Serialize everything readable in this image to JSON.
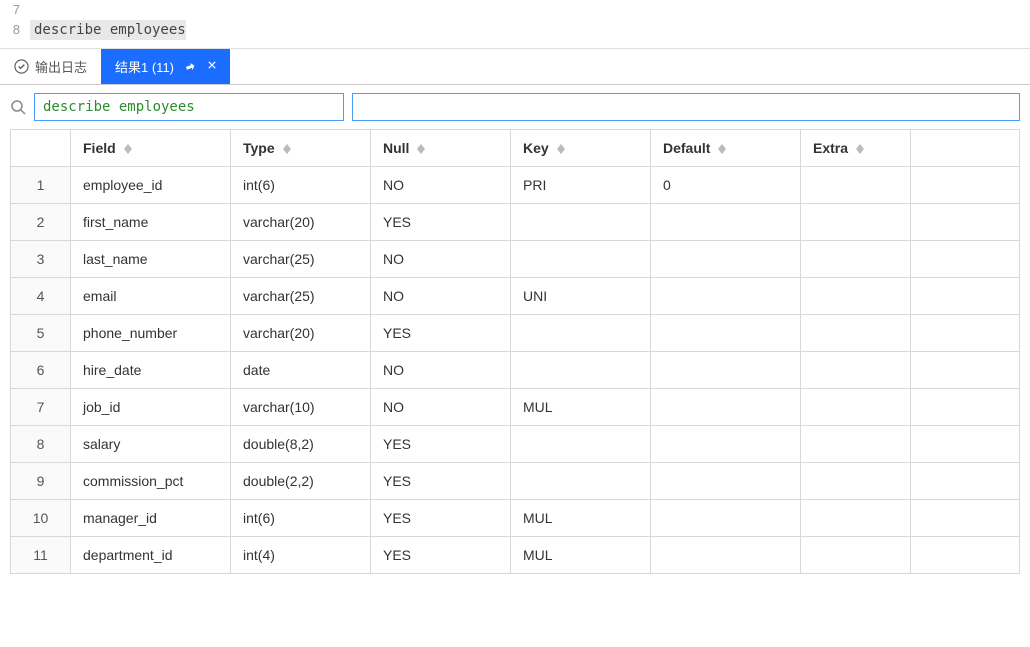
{
  "editor": {
    "lines": [
      {
        "num": "7",
        "text": ""
      },
      {
        "num": "8",
        "text": "describe employees"
      }
    ]
  },
  "tabs": {
    "output_log": "输出日志",
    "result": "结果1 (11)"
  },
  "search": {
    "query": "describe employees",
    "filter_placeholder": ""
  },
  "table": {
    "headers": {
      "rownum": "",
      "field": "Field",
      "type": "Type",
      "null": "Null",
      "key": "Key",
      "default": "Default",
      "extra": "Extra"
    },
    "rows": [
      {
        "n": "1",
        "field": "employee_id",
        "type": "int(6)",
        "null": "NO",
        "key": "PRI",
        "default": "0",
        "extra": ""
      },
      {
        "n": "2",
        "field": "first_name",
        "type": "varchar(20)",
        "null": "YES",
        "key": "",
        "default": "",
        "extra": ""
      },
      {
        "n": "3",
        "field": "last_name",
        "type": "varchar(25)",
        "null": "NO",
        "key": "",
        "default": "",
        "extra": ""
      },
      {
        "n": "4",
        "field": "email",
        "type": "varchar(25)",
        "null": "NO",
        "key": "UNI",
        "default": "",
        "extra": ""
      },
      {
        "n": "5",
        "field": "phone_number",
        "type": "varchar(20)",
        "null": "YES",
        "key": "",
        "default": "",
        "extra": ""
      },
      {
        "n": "6",
        "field": "hire_date",
        "type": "date",
        "null": "NO",
        "key": "",
        "default": "",
        "extra": ""
      },
      {
        "n": "7",
        "field": "job_id",
        "type": "varchar(10)",
        "null": "NO",
        "key": "MUL",
        "default": "",
        "extra": ""
      },
      {
        "n": "8",
        "field": "salary",
        "type": "double(8,2)",
        "null": "YES",
        "key": "",
        "default": "",
        "extra": ""
      },
      {
        "n": "9",
        "field": "commission_pct",
        "type": "double(2,2)",
        "null": "YES",
        "key": "",
        "default": "",
        "extra": ""
      },
      {
        "n": "10",
        "field": "manager_id",
        "type": "int(6)",
        "null": "YES",
        "key": "MUL",
        "default": "",
        "extra": ""
      },
      {
        "n": "11",
        "field": "department_id",
        "type": "int(4)",
        "null": "YES",
        "key": "MUL",
        "default": "",
        "extra": ""
      }
    ]
  }
}
